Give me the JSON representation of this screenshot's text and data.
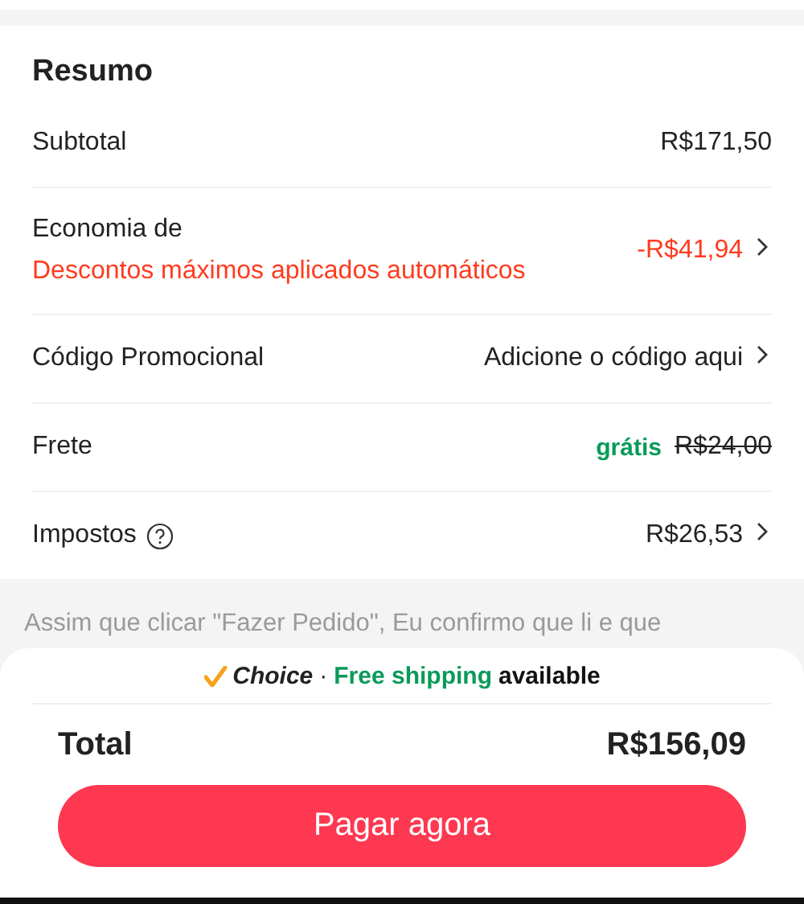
{
  "summary": {
    "title": "Resumo",
    "rows": [
      {
        "kind": "plain",
        "label": "Subtotal",
        "value": "R$171,50",
        "chevron": false
      },
      {
        "kind": "savings",
        "label": "Economia de",
        "note": "Descontos máximos aplicados automáticos",
        "value": "-R$41,94",
        "chevron": true
      },
      {
        "kind": "plain",
        "label": "Código Promocional",
        "value": "Adicione o código aqui",
        "chevron": true
      },
      {
        "kind": "shipping",
        "label": "Frete",
        "free_label": "grátis",
        "original_price": "R$24,00",
        "chevron": false
      },
      {
        "kind": "tax",
        "label": "Impostos",
        "value": "R$26,53",
        "chevron": true
      }
    ]
  },
  "terms": {
    "text": "Assim que clicar \"Fazer Pedido\", Eu confirmo que li e que"
  },
  "checkout": {
    "choice_brand": "Choice",
    "separator": "·",
    "free_shipping": "Free shipping",
    "available": "available",
    "total_label": "Total",
    "total": "R$156,09",
    "pay_button": "Pagar agora"
  }
}
